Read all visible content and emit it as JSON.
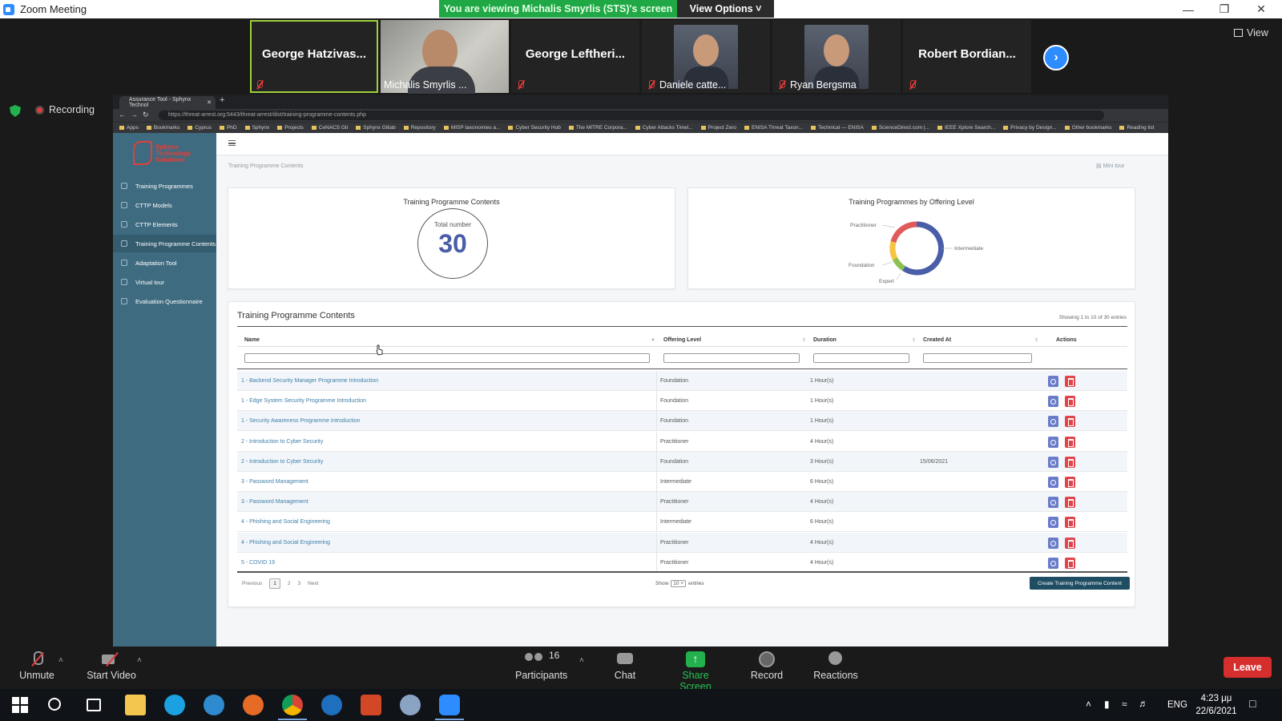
{
  "window": {
    "title": "Zoom Meeting"
  },
  "share_banner": "You are viewing Michalis Smyrlis (STS)'s screen",
  "view_options": "View Options",
  "view_label": "View",
  "recording": "Recording",
  "participants_strip": [
    {
      "name": "George  Hatzivas...",
      "video": false
    },
    {
      "name": "Michalis Smyrlis ...",
      "video": true
    },
    {
      "name": "George  Leftheri...",
      "video": false
    },
    {
      "name": "Daniele catte...",
      "video": true
    },
    {
      "name": "Ryan Bergsma",
      "video": true
    },
    {
      "name": "Robert  Bordian...",
      "video": false
    }
  ],
  "browser": {
    "tab_title": "Assurance Tool - Sphynx Technol",
    "url": "https://threat-arrest.org:5443/threat-arrest/dist/training-programme-contents.php",
    "bookmarks": [
      "Apps",
      "Bookmarks",
      "Cyprus",
      "PhD",
      "Sphynx",
      "Projects",
      "CeNACS Git",
      "Sphynx Gitlab",
      "Repository",
      "MISP taxonomies a...",
      "Cyber Security Hub",
      "The MITRE Corpora...",
      "Cyber Attacks Timel...",
      "Project Zero",
      "ENISA Threat Taxon...",
      "Technical — ENISA",
      "ScienceDirect.com |...",
      "IEEE Xplore Search...",
      "Privacy by Design...",
      "Other bookmarks",
      "Reading list"
    ]
  },
  "app": {
    "logo_text": "Sphynx Technology Solutions",
    "sidebar": [
      "Training Programmes",
      "CTTP Models",
      "CTTP Elements",
      "Training Programme Contents",
      "Adaptation Tool",
      "Virtual tour",
      "Evaluation Questionnaire"
    ],
    "breadcrumb": "Training Programme Contents",
    "mini_tour": "Mini tour",
    "total_card": {
      "title": "Training Programme Contents",
      "label": "Total number",
      "value": "30"
    },
    "donut_card": {
      "title": "Training Programmes by Offering Level",
      "labels": [
        "Practitioner",
        "Intermediate",
        "Foundation",
        "Expert"
      ]
    },
    "table": {
      "title": "Training Programme Contents",
      "showing": "Showing 1 to 10 of 30 entries",
      "columns": [
        "Name",
        "Offering Level",
        "Duration",
        "Created At",
        "Actions"
      ],
      "rows": [
        {
          "name": "1 - Backend Security Manager Programme Introduction",
          "level": "Foundation",
          "duration": "1 Hour(s)",
          "created": ""
        },
        {
          "name": "1 - Edge System Security Programme Introduction",
          "level": "Foundation",
          "duration": "1 Hour(s)",
          "created": ""
        },
        {
          "name": "1 - Security Awareness Programme Introduction",
          "level": "Foundation",
          "duration": "1 Hour(s)",
          "created": ""
        },
        {
          "name": "2 - Introduction to Cyber Security",
          "level": "Practitioner",
          "duration": "4 Hour(s)",
          "created": ""
        },
        {
          "name": "2 - Introduction to Cyber Security",
          "level": "Foundation",
          "duration": "3 Hour(s)",
          "created": "15/06/2021"
        },
        {
          "name": "3 - Password Management",
          "level": "Intermediate",
          "duration": "6 Hour(s)",
          "created": ""
        },
        {
          "name": "3 - Password Management",
          "level": "Practitioner",
          "duration": "4 Hour(s)",
          "created": ""
        },
        {
          "name": "4 - Phishing and Social Engineering",
          "level": "Intermediate",
          "duration": "6 Hour(s)",
          "created": ""
        },
        {
          "name": "4 - Phishing and Social Engineering",
          "level": "Practitioner",
          "duration": "4 Hour(s)",
          "created": ""
        },
        {
          "name": "5 - COVID 19",
          "level": "Practitioner",
          "duration": "4 Hour(s)",
          "created": ""
        }
      ],
      "pager": {
        "previous": "Previous",
        "pages": [
          "1",
          "2",
          "3"
        ],
        "next": "Next"
      },
      "entries": {
        "show": "Show",
        "value": "10",
        "suffix": "entries"
      },
      "create_button": "Create Training Programme Content"
    }
  },
  "toolbar": {
    "unmute": "Unmute",
    "start_video": "Start Video",
    "participants": "Participants",
    "participants_count": "16",
    "chat": "Chat",
    "share_screen": "Share Screen",
    "record": "Record",
    "reactions": "Reactions",
    "leave": "Leave"
  },
  "taskbar": {
    "lang": "ENG",
    "time": "4:23 μμ",
    "date": "22/6/2021"
  },
  "colors": {
    "zoom_blue": "#2d8cff",
    "share_green": "#1fa845",
    "sidebar": "#3f6b80",
    "link": "#3f7fa8",
    "leave_red": "#d62d2d"
  }
}
